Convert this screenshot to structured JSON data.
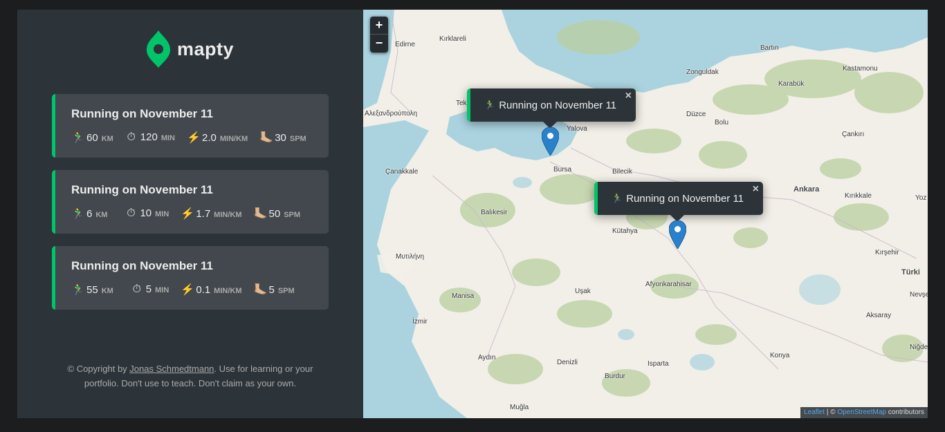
{
  "app": {
    "logo_text": "mapty",
    "accent_color": "#00c46a"
  },
  "workouts": [
    {
      "title": "Running on November 11",
      "distance": {
        "icon": "🏃‍♂️",
        "value": "60",
        "unit": "km"
      },
      "duration": {
        "icon": "⏱",
        "value": "120",
        "unit": "min"
      },
      "pace": {
        "icon": "⚡️",
        "value": "2.0",
        "unit": "min/km"
      },
      "cadence": {
        "icon": "🦶🏼",
        "value": "30",
        "unit": "spm"
      }
    },
    {
      "title": "Running on November 11",
      "distance": {
        "icon": "🏃‍♂️",
        "value": "6",
        "unit": "km"
      },
      "duration": {
        "icon": "⏱",
        "value": "10",
        "unit": "min"
      },
      "pace": {
        "icon": "⚡️",
        "value": "1.7",
        "unit": "min/km"
      },
      "cadence": {
        "icon": "🦶🏼",
        "value": "50",
        "unit": "spm"
      }
    },
    {
      "title": "Running on November 11",
      "distance": {
        "icon": "🏃‍♂️",
        "value": "55",
        "unit": "km"
      },
      "duration": {
        "icon": "⏱",
        "value": "5",
        "unit": "min"
      },
      "pace": {
        "icon": "⚡️",
        "value": "0.1",
        "unit": "min/km"
      },
      "cadence": {
        "icon": "🦶🏼",
        "value": "5",
        "unit": "spm"
      }
    }
  ],
  "copyright": {
    "prefix": "© Copyright by ",
    "author": "Jonas Schmedtmann",
    "suffix": ". Use for learning or your portfolio. Don't use to teach. Don't claim as your own."
  },
  "map": {
    "zoom_in": "+",
    "zoom_out": "−",
    "popups": [
      {
        "icon": "🏃‍♂️",
        "text": "Running on November 11",
        "close": "×"
      },
      {
        "icon": "🏃‍♂️",
        "text": "Running on November 11",
        "close": "×"
      }
    ],
    "cities": [
      "Edirne",
      "Kırklareli",
      "Tek",
      "Αλεξανδρούπολη",
      "Yalova",
      "Bursa",
      "Bilecik",
      "Çanakkale",
      "Balıkesir",
      "Μυτιλήνη",
      "Kütahya",
      "Afyonkarahisar",
      "Uşak",
      "Manisa",
      "İzmir",
      "Aydın",
      "Denizli",
      "Burdur",
      "Isparta",
      "Muğla",
      "Zonguldak",
      "Bartın",
      "Kastamonu",
      "Karabük",
      "Düzce",
      "Bolu",
      "Çankırı",
      "Ankara",
      "Kırıkkale",
      "Yoz",
      "Kırşehir",
      "Türki",
      "Nevşe",
      "Aksaray",
      "Konya",
      "Niğde"
    ],
    "attribution": {
      "leaflet": "Leaflet",
      "separator": " | © ",
      "osm": "OpenStreetMap",
      "contributors": " contributors"
    }
  }
}
